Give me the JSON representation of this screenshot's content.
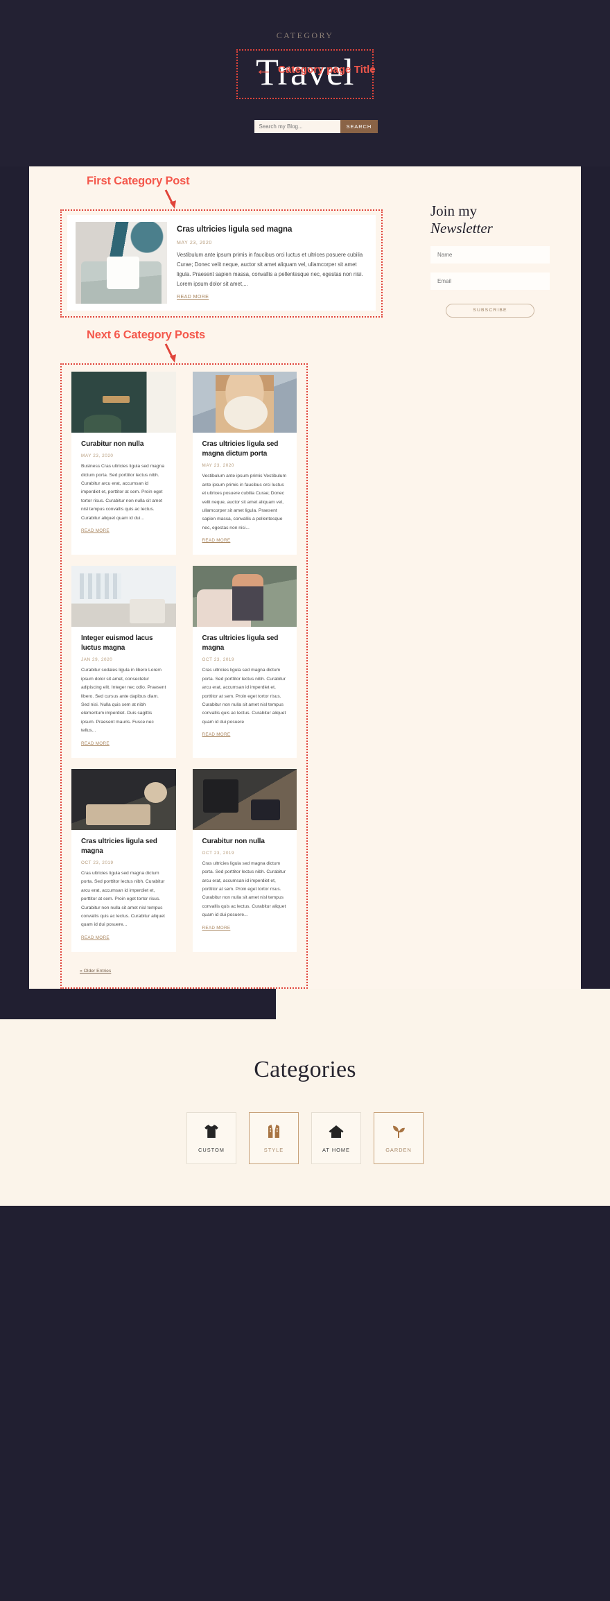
{
  "header": {
    "eyebrow": "CATEGORY",
    "title": "Travel",
    "annotation": "Category page Title",
    "arrow_glyph": "←"
  },
  "search": {
    "placeholder": "Search my Blog...",
    "button_label": "SEARCH"
  },
  "annotations": {
    "first_post": "First Category Post",
    "next_posts": "Next 6 Category Posts"
  },
  "featured_post": {
    "title": "Cras ultricies ligula sed magna",
    "date": "MAY 23, 2020",
    "excerpt": "Vestibulum ante ipsum primis in faucibus orci luctus et ultrices posuere cubilia Curae; Donec velit neque, auctor sit amet aliquam vel, ullamcorper sit amet ligula. Praesent sapien massa, convallis a pellentesque nec, egestas non nisi. Lorem ipsum dolor sit amet,...",
    "read_more": "READ MORE"
  },
  "newsletter": {
    "title_line1": "Join my",
    "title_line2": "Newsletter",
    "name_placeholder": "Name",
    "email_placeholder": "Email",
    "subscribe_label": "SUBSCRIBE"
  },
  "posts": [
    {
      "title": "Curabitur non nulla",
      "date": "MAY 23, 2020",
      "excerpt": "Business Cras ultricies ligula sed magna dictum porta. Sed porttitor lectus nibh. Curabitur arcu erat, accumsan id imperdiet et, porttitor at sem. Proin eget tortor risus. Curabitur non nulla sit amet nisl tempus convallis quis ac lectus. Curabitur aliquet quam id dui...",
      "read_more": "READ MORE"
    },
    {
      "title": "Cras ultricies ligula sed magna dictum porta",
      "date": "MAY 23, 2020",
      "excerpt": "Vestibulum ante ipsum primis Vestibulum ante ipsum primis in faucibus orci luctus et ultrices posuere cubilia Curae; Donec velit neque, auctor sit amet aliquam vel, ullamcorper sit amet ligula. Praesent sapien massa, convallis a pellentesque nec, egestas non nisi...",
      "read_more": "READ MORE"
    },
    {
      "title": "Integer euismod lacus luctus magna",
      "date": "JAN 29, 2020",
      "excerpt": "Curabitur sodales ligula in libero Lorem ipsum dolor sit amet, consectetur adipiscing elit. Integer nec odio. Praesent libero. Sed cursus ante dapibus diam. Sed nisi. Nulla quis sem at nibh elementum imperdiet. Duis sagittis ipsum. Praesent mauris. Fusce nec tellus...",
      "read_more": "READ MORE"
    },
    {
      "title": "Cras ultricies ligula sed magna",
      "date": "OCT 23, 2019",
      "excerpt": "Cras ultricies ligula sed magna dictum porta. Sed porttitor lectus nibh. Curabitur arcu erat, accumsan id imperdiet et, porttitor at sem. Proin eget tortor risus. Curabitur non nulla sit amet nisl tempus convallis quis ac lectus. Curabitur aliquet quam id dui posuere",
      "read_more": "READ MORE"
    },
    {
      "title": "Cras ultricies ligula sed magna",
      "date": "OCT 23, 2019",
      "excerpt": "Cras ultricies ligula sed magna dictum porta. Sed porttitor lectus nibh. Curabitur arcu erat, accumsan id imperdiet et, porttitor at sem. Proin eget tortor risus. Curabitur non nulla sit amet nisl tempus convallis quis ac lectus. Curabitur aliquet quam id dui posuere...",
      "read_more": "READ MORE"
    },
    {
      "title": "Curabitur non nulla",
      "date": "OCT 23, 2019",
      "excerpt": "Cras ultricies ligula sed magna dictum porta. Sed porttitor lectus nibh. Curabitur arcu erat, accumsan id imperdiet et, porttitor at sem. Proin eget tortor risus. Curabitur non nulla sit amet nisl tempus convallis quis ac lectus. Curabitur aliquet quam id dui posuere...",
      "read_more": "READ MORE"
    }
  ],
  "pagination": {
    "older_entries": "« Older Entries"
  },
  "footer": {
    "title": "Categories",
    "categories": [
      {
        "label": "CUSTOM",
        "icon": "tshirt-icon",
        "accent": false
      },
      {
        "label": "STYLE",
        "icon": "vest-icon",
        "accent": true
      },
      {
        "label": "AT HOME",
        "icon": "house-icon",
        "accent": false
      },
      {
        "label": "GARDEN",
        "icon": "sprout-icon",
        "accent": true
      }
    ]
  },
  "colors": {
    "annotation_red": "#f4584c",
    "dark_bg": "#211f31",
    "cream": "#fdf5ec",
    "accent_brown": "#8a6346",
    "date_gold": "#b79c7c"
  }
}
